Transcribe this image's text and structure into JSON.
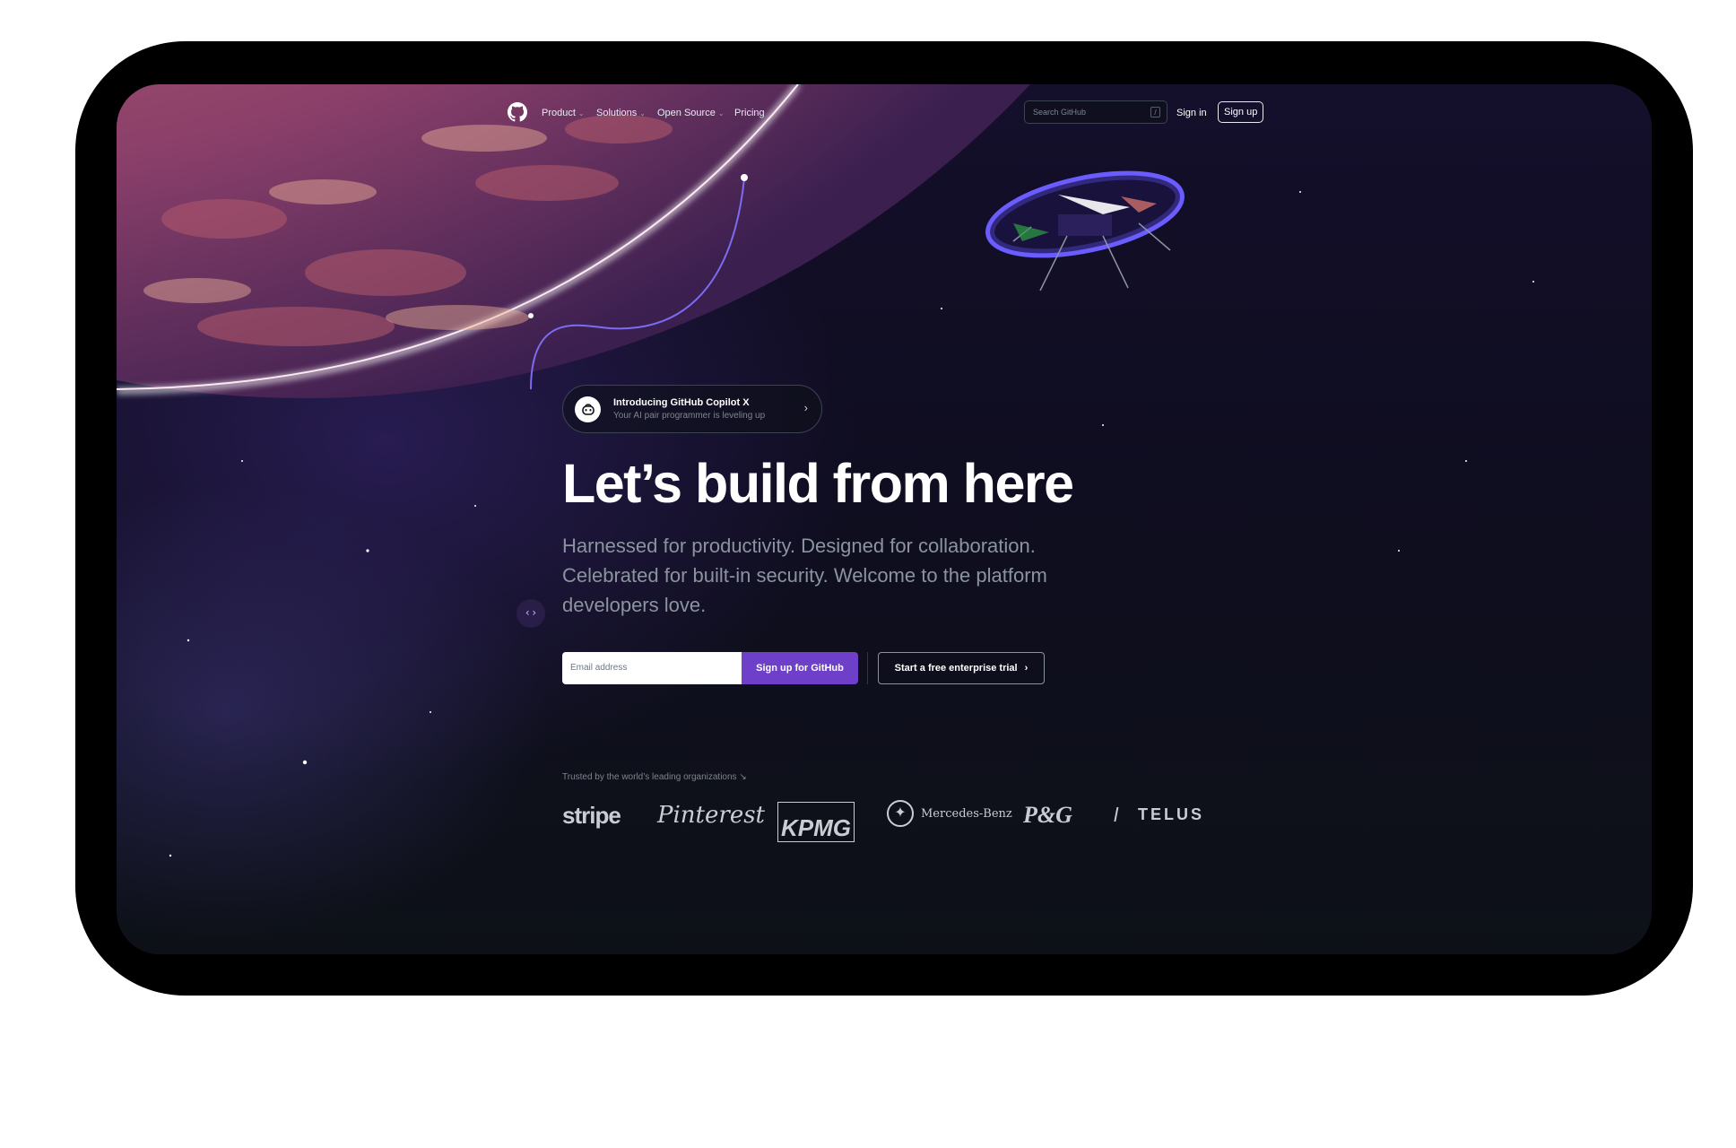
{
  "nav": {
    "items": [
      {
        "label": "Product",
        "dropdown": true
      },
      {
        "label": "Solutions",
        "dropdown": true
      },
      {
        "label": "Open Source",
        "dropdown": true
      },
      {
        "label": "Pricing",
        "dropdown": false
      }
    ],
    "search_placeholder": "Search GitHub",
    "search_key": "/",
    "signin": "Sign in",
    "signup": "Sign up"
  },
  "hero": {
    "announcement_title": "Introducing GitHub Copilot X",
    "announcement_subtitle": "Your AI pair programmer is leveling up",
    "heading": "Let’s build from here",
    "subheading": "Harnessed for productivity. Designed for collaboration. Celebrated for built-in security. Welcome to the platform developers love.",
    "email_placeholder": "Email address",
    "cta_signup": "Sign up for GitHub",
    "cta_trial": "Start a free enterprise trial"
  },
  "trusted": {
    "label": "Trusted by the world’s leading organizations ↘",
    "logos": [
      "stripe",
      "Pinterest",
      "KPMG",
      "Mercedes-Benz",
      "P&G",
      "TELUS"
    ]
  },
  "colors": {
    "accent": "#6e40c9",
    "background": "#0d1117",
    "planet": "#e07f6a"
  }
}
